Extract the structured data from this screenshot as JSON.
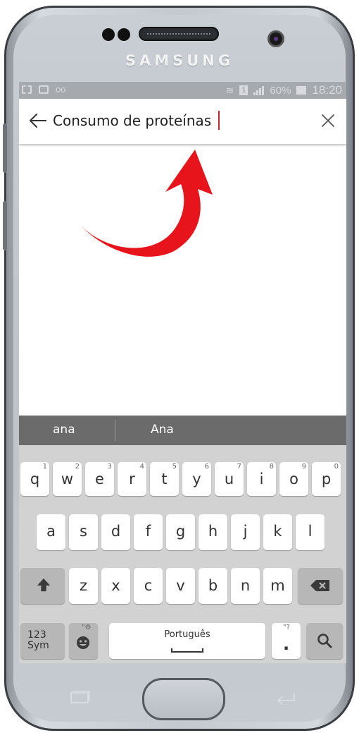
{
  "device": {
    "brand": "SAMSUNG"
  },
  "status_bar": {
    "icons_left": [
      "notification-icon",
      "gallery-icon",
      "voicemail-icon"
    ],
    "sim": "1",
    "battery": "60%",
    "time": "18:20"
  },
  "search": {
    "query": "Consumo de proteínas",
    "back_icon": "back-arrow-icon",
    "clear_icon": "close-icon"
  },
  "annotation": {
    "arrow_color": "#e8141b"
  },
  "suggestions": [
    "ana",
    "Ana"
  ],
  "keyboard": {
    "row1": [
      {
        "k": "q",
        "n": "1"
      },
      {
        "k": "w",
        "n": "2"
      },
      {
        "k": "e",
        "n": "3"
      },
      {
        "k": "r",
        "n": "4"
      },
      {
        "k": "t",
        "n": "5"
      },
      {
        "k": "y",
        "n": "6"
      },
      {
        "k": "u",
        "n": "7"
      },
      {
        "k": "i",
        "n": "8"
      },
      {
        "k": "o",
        "n": "9"
      },
      {
        "k": "p",
        "n": "0"
      }
    ],
    "row2": [
      "a",
      "s",
      "d",
      "f",
      "g",
      "h",
      "j",
      "k",
      "l"
    ],
    "row3": [
      "z",
      "x",
      "c",
      "v",
      "b",
      "n",
      "m"
    ],
    "sym_label_1": "123",
    "sym_label_2": "Sym",
    "language": "Português",
    "period": ".",
    "period_hint": "\"?",
    "emoji_hint": "\"⚙"
  },
  "nav_bar": {
    "recent_icon": "recent-apps-icon",
    "back_icon": "back-icon"
  }
}
